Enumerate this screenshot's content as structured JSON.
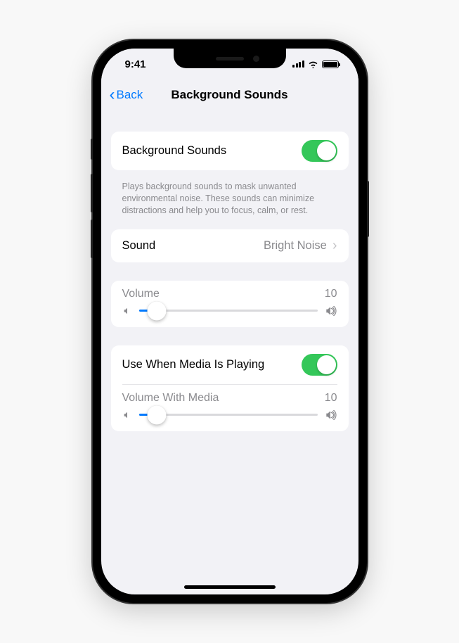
{
  "statusBar": {
    "time": "9:41"
  },
  "nav": {
    "back": "Back",
    "title": "Background Sounds"
  },
  "main": {
    "toggleRow": {
      "label": "Background Sounds",
      "enabled": true
    },
    "description": "Plays background sounds to mask unwanted environmental noise. These sounds can minimize distractions and help you to focus, calm, or rest.",
    "sound": {
      "label": "Sound",
      "value": "Bright Noise"
    },
    "volume": {
      "label": "Volume",
      "value": "10",
      "percent": 10
    },
    "media": {
      "label": "Use When Media Is Playing",
      "enabled": true,
      "volumeLabel": "Volume With Media",
      "volumeValue": "10",
      "volumePercent": 10
    }
  }
}
